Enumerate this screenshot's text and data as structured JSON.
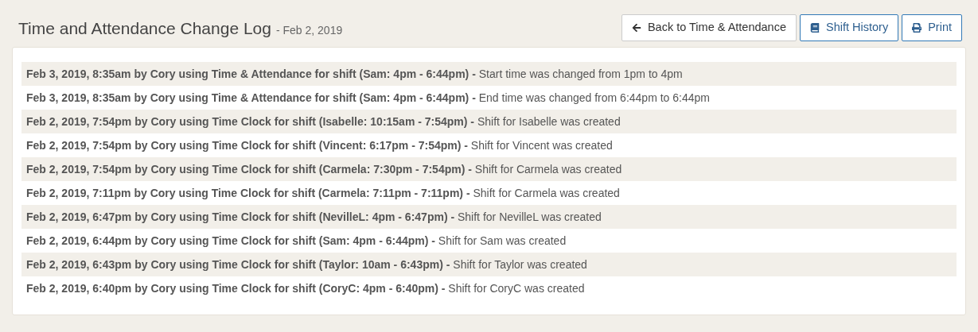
{
  "header": {
    "title": "Time and Attendance Change Log",
    "subtitle": "- Feb 2, 2019"
  },
  "buttons": [
    {
      "label": "Back to Time & Attendance",
      "kind": "back"
    },
    {
      "label": "Shift History",
      "kind": "history"
    },
    {
      "label": "Print",
      "kind": "print"
    }
  ],
  "log": [
    "**Feb 3, 2019, 8:35am by Cory using Time & Attendance for shift (Sam: 4pm - 6:44pm) -** Start time was changed from 1pm to 4pm",
    "**Feb 3, 2019, 8:35am by Cory using Time & Attendance for shift (Sam: 4pm - 6:44pm) -** End time was changed from 6:44pm to 6:44pm",
    "**Feb 2, 2019, 7:54pm by Cory using Time Clock for shift (Isabelle: 10:15am - 7:54pm) -** Shift for Isabelle was created",
    "**Feb 2, 2019, 7:54pm by Cory using Time Clock for shift (Vincent: 6:17pm - 7:54pm) -** Shift for Vincent was created",
    "**Feb 2, 2019, 7:54pm by Cory using Time Clock for shift (Carmela: 7:30pm - 7:54pm) -** Shift for Carmela was created",
    "**Feb 2, 2019, 7:11pm by Cory using Time Clock for shift (Carmela: 7:11pm - 7:11pm) -** Shift for Carmela was created",
    "**Feb 2, 2019, 6:47pm by Cory using Time Clock for shift (NevilleL: 4pm - 6:47pm) -** Shift for NevilleL was created",
    "**Feb 2, 2019, 6:44pm by Cory using Time Clock for shift (Sam: 4pm - 6:44pm) -** Shift for Sam was created",
    "**Feb 2, 2019, 6:43pm by Cory using Time Clock for shift (Taylor: 10am - 6:43pm) -** Shift for Taylor was created",
    "**Feb 2, 2019, 6:40pm by Cory using Time Clock for shift (CoryC: 4pm - 6:40pm) -** Shift for CoryC was created"
  ]
}
